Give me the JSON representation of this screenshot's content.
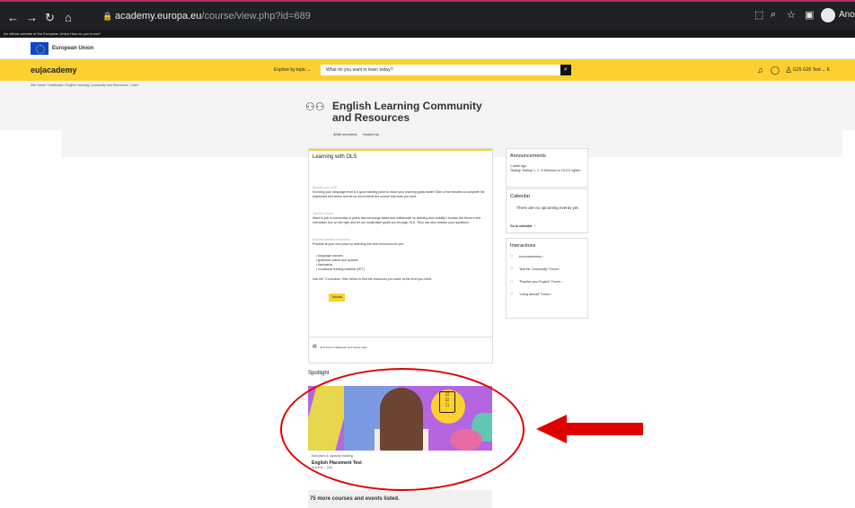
{
  "browser": {
    "back_icon": "back-arrow-icon",
    "forward_icon": "forward-arrow-icon",
    "reload_icon": "reload-icon",
    "home_icon": "home-icon",
    "url_domain": "academy.europa.eu",
    "url_path": "/course/view.php?id=689",
    "profile_name": "Anony"
  },
  "official_bar": "An official website of the European Union   How do you know?",
  "eu_header": {
    "label": "European Union"
  },
  "site_header": {
    "logo": "eu|academy",
    "explore": "Explore by topic",
    "search_placeholder": "What do you want to learn today?",
    "user_name": "G25 G25 Test"
  },
  "breadcrumb": "Site Home  /  Dashboard  /  English Learning Community and Resources  /  Learn",
  "community": {
    "title": "English Learning Community and Resources",
    "members": "4068 members",
    "hosted": "Hosted by"
  },
  "main_card": {
    "title": "Learning with OLS",
    "sections": [
      {
        "heading": "Assess your level",
        "body": "Knowing your language level is a good starting point to reach your learning goals faster! Take a few minutes to complete the placement test below and let us recommend the course that suits you best."
      },
      {
        "heading": "Join the Forum",
        "body": "Want to join a community of peers that exchange ideas and collaborate on learning and mobility? Access the forum in the interaction box on the right and let our moderation guide you through OLS. They can also answer your questions."
      },
      {
        "heading": "Explore learning resources",
        "body": "Practise at your own pace by selecting the best resources for you:"
      }
    ],
    "list": [
      "language courses",
      "grammar videos and quizzes",
      "flashcards",
      "vocational training material (VET)"
    ],
    "curriculum_text": "Use the \"Curriculum\" filter below to find the resources you want, at the level you need.",
    "tutorial_button": "Tutorial",
    "footer_text": "OLS Forum Netiquette and House rules"
  },
  "announcements": {
    "title": "Announcements",
    "time": "1 week ago",
    "text": "Testing! Testing! 1, 2, 3! Welcome to OLS E nglish!"
  },
  "calendar": {
    "title": "Calendar",
    "empty": "There are no upcoming events yet.",
    "link": "Go to calendar"
  },
  "interactions": {
    "title": "Interactions",
    "items": [
      "Announcements",
      "\"Ask the Community\" Forum",
      "\"Practice your English\" Forum",
      "\"Living abroad\" Forum"
    ]
  },
  "spotlight": {
    "title": "Spotlight",
    "category": "Education & capacity building",
    "course_name": "English Placement Test",
    "rating": "★★★★☆",
    "rating_count": "(18)"
  },
  "more_courses": "75 more courses and events listed.",
  "colors": {
    "brand_yellow": "#fcd02f",
    "annotation_red": "#e00000"
  }
}
